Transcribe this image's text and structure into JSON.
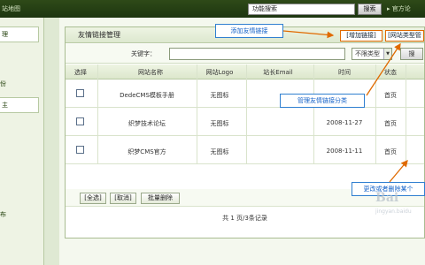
{
  "topbar": {
    "map_label": "站地图",
    "feature_search": "功能搜索",
    "search_button": "搜索",
    "home_link": "官方论"
  },
  "sidebar": {
    "box1": "理",
    "text1": "份",
    "box2": "主",
    "text2": "布"
  },
  "panel": {
    "title": "友情链接管理",
    "add_link": "[增加链接]",
    "type_manage": "[网站类型管"
  },
  "filter": {
    "keyword_label": "关键字：",
    "keyword_value": "",
    "type_select": "不限类型",
    "search_button": "搜"
  },
  "table": {
    "headers": [
      "选择",
      "网站名称",
      "网站Logo",
      "站长Email",
      "时间",
      "状态"
    ],
    "rows": [
      {
        "name": "DedeCMS模板手册",
        "logo": "无图标",
        "email": "",
        "time": "",
        "status": "首页"
      },
      {
        "name": "织梦技术论坛",
        "logo": "无图标",
        "email": "",
        "time": "2008-11-27",
        "status": "首页"
      },
      {
        "name": "织梦CMS官方",
        "logo": "无图标",
        "email": "",
        "time": "2008-11-11",
        "status": "首页"
      }
    ]
  },
  "actions": {
    "select_all": "[全选]",
    "cancel": "[取消]",
    "batch_delete": "批量删除"
  },
  "pager": "共 1 页/3条记录",
  "callouts": {
    "add": "添加友情链接",
    "manage_category": "管理友情链接分类",
    "edit_delete": "更改或者删除某个"
  },
  "watermark": {
    "brand": "Bai",
    "sub": "jingyan.baidu"
  },
  "colors": {
    "topbar": "#1d3510",
    "panel_border": "#a9bd92",
    "callout_border": "#2f7fd0",
    "button_highlight": "#e06a00"
  }
}
